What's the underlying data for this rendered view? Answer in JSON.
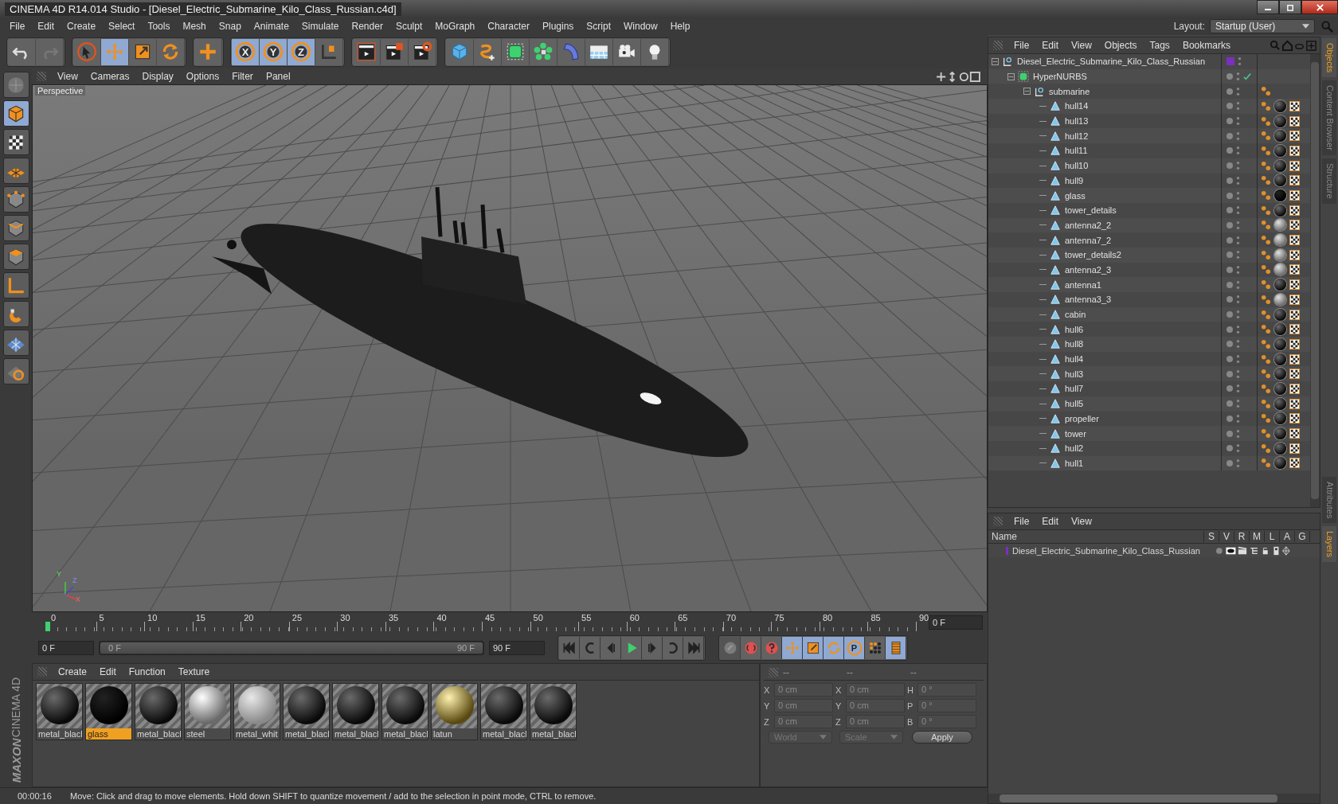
{
  "window": {
    "title": "CINEMA 4D R14.014 Studio - [Diesel_Electric_Submarine_Kilo_Class_Russian.c4d]"
  },
  "menu_bar": [
    "File",
    "Edit",
    "Create",
    "Select",
    "Tools",
    "Mesh",
    "Snap",
    "Animate",
    "Simulate",
    "Render",
    "Sculpt",
    "MoGraph",
    "Character",
    "Plugins",
    "Script",
    "Window",
    "Help"
  ],
  "layout": {
    "label": "Layout:",
    "value": "Startup (User)"
  },
  "toolbar": [
    [
      {
        "kind": "undo",
        "selected": false
      },
      {
        "kind": "redo",
        "selected": false
      }
    ],
    [
      {
        "kind": "select",
        "selected": false
      },
      {
        "kind": "move",
        "selected": true
      },
      {
        "kind": "scale",
        "selected": false
      },
      {
        "kind": "rotate",
        "selected": false
      }
    ],
    [
      {
        "kind": "add",
        "selected": false
      }
    ],
    [
      {
        "kind": "axis",
        "label": "X",
        "selected": true
      },
      {
        "kind": "axis",
        "label": "Y",
        "selected": true
      },
      {
        "kind": "axis",
        "label": "Z",
        "selected": true
      },
      {
        "kind": "coords",
        "selected": false
      }
    ],
    [
      {
        "kind": "render-view",
        "selected": false
      },
      {
        "kind": "render-picture",
        "selected": false
      },
      {
        "kind": "render-settings",
        "selected": false
      }
    ],
    [
      {
        "kind": "cube",
        "selected": false
      },
      {
        "kind": "spline",
        "selected": false
      },
      {
        "kind": "nurbs",
        "selected": false
      },
      {
        "kind": "array",
        "selected": false
      },
      {
        "kind": "deformer",
        "selected": false
      },
      {
        "kind": "floor",
        "selected": false
      },
      {
        "kind": "camera",
        "selected": false
      },
      {
        "kind": "light",
        "selected": false
      }
    ]
  ],
  "left_tools": [
    {
      "kind": "view",
      "selected": false
    },
    {
      "kind": "model",
      "selected": true
    },
    {
      "kind": "texture",
      "selected": false
    },
    {
      "kind": "workplane",
      "selected": false
    },
    {
      "kind": "points",
      "selected": false
    },
    {
      "kind": "edges",
      "selected": false
    },
    {
      "kind": "polygons",
      "selected": false
    },
    {
      "kind": "axis-mode",
      "selected": false
    },
    {
      "kind": "magnet",
      "selected": false
    },
    {
      "kind": "snap-grid",
      "selected": false
    },
    {
      "kind": "snap-lock",
      "selected": false
    }
  ],
  "viewport": {
    "menu": [
      "View",
      "Cameras",
      "Display",
      "Options",
      "Filter",
      "Panel"
    ],
    "label": "Perspective",
    "axes": [
      "Y",
      "Z",
      "X"
    ]
  },
  "objects": {
    "menu": [
      "File",
      "Edit",
      "View",
      "Objects",
      "Tags",
      "Bookmarks"
    ],
    "tree": [
      {
        "name": "Diesel_Electric_Submarine_Kilo_Class_Russian",
        "kind": "null",
        "expanded": true,
        "color": "#7b2fbe",
        "children": [
          {
            "name": "HyperNURBS",
            "kind": "hypernurbs",
            "expanded": true,
            "enabled": true,
            "children": [
              {
                "name": "submarine",
                "kind": "null",
                "expanded": true,
                "tags": [
                  {
                    "kind": "phong"
                  }
                ],
                "children": [
                  {
                    "name": "hull14",
                    "kind": "polygon",
                    "tags": [
                      {
                        "kind": "phong"
                      },
                      {
                        "kind": "material-dark"
                      },
                      {
                        "kind": "uvw"
                      }
                    ]
                  },
                  {
                    "name": "hull13",
                    "kind": "polygon",
                    "tags": [
                      {
                        "kind": "phong"
                      },
                      {
                        "kind": "material-dark"
                      },
                      {
                        "kind": "uvw"
                      }
                    ]
                  },
                  {
                    "name": "hull12",
                    "kind": "polygon",
                    "tags": [
                      {
                        "kind": "phong"
                      },
                      {
                        "kind": "material-dark"
                      },
                      {
                        "kind": "uvw"
                      }
                    ]
                  },
                  {
                    "name": "hull11",
                    "kind": "polygon",
                    "tags": [
                      {
                        "kind": "phong"
                      },
                      {
                        "kind": "material-dark"
                      },
                      {
                        "kind": "uvw"
                      }
                    ]
                  },
                  {
                    "name": "hull10",
                    "kind": "polygon",
                    "tags": [
                      {
                        "kind": "phong"
                      },
                      {
                        "kind": "material-dark"
                      },
                      {
                        "kind": "uvw"
                      }
                    ]
                  },
                  {
                    "name": "hull9",
                    "kind": "polygon",
                    "tags": [
                      {
                        "kind": "phong"
                      },
                      {
                        "kind": "material-dark"
                      },
                      {
                        "kind": "uvw"
                      }
                    ]
                  },
                  {
                    "name": "glass",
                    "kind": "polygon",
                    "tags": [
                      {
                        "kind": "phong"
                      },
                      {
                        "kind": "material-black"
                      },
                      {
                        "kind": "uvw"
                      }
                    ]
                  },
                  {
                    "name": "tower_details",
                    "kind": "polygon",
                    "tags": [
                      {
                        "kind": "phong"
                      },
                      {
                        "kind": "material-dark"
                      },
                      {
                        "kind": "uvw"
                      }
                    ]
                  },
                  {
                    "name": "antenna2_2",
                    "kind": "polygon",
                    "tags": [
                      {
                        "kind": "phong"
                      },
                      {
                        "kind": "material-grey"
                      },
                      {
                        "kind": "uvw"
                      }
                    ]
                  },
                  {
                    "name": "antenna7_2",
                    "kind": "polygon",
                    "tags": [
                      {
                        "kind": "phong"
                      },
                      {
                        "kind": "material-grey"
                      },
                      {
                        "kind": "uvw"
                      }
                    ]
                  },
                  {
                    "name": "tower_details2",
                    "kind": "polygon",
                    "tags": [
                      {
                        "kind": "phong"
                      },
                      {
                        "kind": "material-grey"
                      },
                      {
                        "kind": "uvw"
                      }
                    ]
                  },
                  {
                    "name": "antenna2_3",
                    "kind": "polygon",
                    "tags": [
                      {
                        "kind": "phong"
                      },
                      {
                        "kind": "material-grey"
                      },
                      {
                        "kind": "uvw"
                      }
                    ]
                  },
                  {
                    "name": "antenna1",
                    "kind": "polygon",
                    "tags": [
                      {
                        "kind": "phong"
                      },
                      {
                        "kind": "material-dark"
                      },
                      {
                        "kind": "uvw"
                      }
                    ]
                  },
                  {
                    "name": "antenna3_3",
                    "kind": "polygon",
                    "tags": [
                      {
                        "kind": "phong"
                      },
                      {
                        "kind": "material-grey"
                      },
                      {
                        "kind": "uvw"
                      }
                    ]
                  },
                  {
                    "name": "cabin",
                    "kind": "polygon",
                    "tags": [
                      {
                        "kind": "phong"
                      },
                      {
                        "kind": "material-dark"
                      },
                      {
                        "kind": "uvw"
                      }
                    ]
                  },
                  {
                    "name": "hull6",
                    "kind": "polygon",
                    "tags": [
                      {
                        "kind": "phong"
                      },
                      {
                        "kind": "material-dark"
                      },
                      {
                        "kind": "uvw"
                      }
                    ]
                  },
                  {
                    "name": "hull8",
                    "kind": "polygon",
                    "tags": [
                      {
                        "kind": "phong"
                      },
                      {
                        "kind": "material-dark"
                      },
                      {
                        "kind": "uvw"
                      }
                    ]
                  },
                  {
                    "name": "hull4",
                    "kind": "polygon",
                    "tags": [
                      {
                        "kind": "phong"
                      },
                      {
                        "kind": "material-dark"
                      },
                      {
                        "kind": "uvw"
                      }
                    ]
                  },
                  {
                    "name": "hull3",
                    "kind": "polygon",
                    "tags": [
                      {
                        "kind": "phong"
                      },
                      {
                        "kind": "material-dark"
                      },
                      {
                        "kind": "uvw"
                      }
                    ]
                  },
                  {
                    "name": "hull7",
                    "kind": "polygon",
                    "tags": [
                      {
                        "kind": "phong"
                      },
                      {
                        "kind": "material-dark"
                      },
                      {
                        "kind": "uvw"
                      }
                    ]
                  },
                  {
                    "name": "hull5",
                    "kind": "polygon",
                    "tags": [
                      {
                        "kind": "phong"
                      },
                      {
                        "kind": "material-dark"
                      },
                      {
                        "kind": "uvw"
                      }
                    ]
                  },
                  {
                    "name": "propeller",
                    "kind": "polygon",
                    "tags": [
                      {
                        "kind": "phong"
                      },
                      {
                        "kind": "material-dark"
                      },
                      {
                        "kind": "uvw"
                      }
                    ]
                  },
                  {
                    "name": "tower",
                    "kind": "polygon",
                    "tags": [
                      {
                        "kind": "phong"
                      },
                      {
                        "kind": "material-dark"
                      },
                      {
                        "kind": "uvw"
                      }
                    ]
                  },
                  {
                    "name": "hull2",
                    "kind": "polygon",
                    "tags": [
                      {
                        "kind": "phong"
                      },
                      {
                        "kind": "material-dark"
                      },
                      {
                        "kind": "uvw"
                      }
                    ]
                  },
                  {
                    "name": "hull1",
                    "kind": "polygon",
                    "tags": [
                      {
                        "kind": "phong"
                      },
                      {
                        "kind": "material-dark"
                      },
                      {
                        "kind": "uvw"
                      }
                    ]
                  }
                ]
              }
            ]
          }
        ]
      }
    ]
  },
  "side_tabs_top": [
    {
      "label": "Objects",
      "selected": true
    },
    {
      "label": "Content Browser",
      "selected": false
    },
    {
      "label": "Structure",
      "selected": false
    }
  ],
  "side_tabs_bottom": [
    {
      "label": "Attributes",
      "selected": false
    },
    {
      "label": "Layers",
      "selected": true
    }
  ],
  "layers": {
    "menu": [
      "File",
      "Edit",
      "View"
    ],
    "columns": [
      "Name",
      "S",
      "V",
      "R",
      "M",
      "L",
      "A",
      "G"
    ],
    "rows": [
      {
        "name": "Diesel_Electric_Submarine_Kilo_Class_Russian",
        "color": "#7b2fbe"
      }
    ]
  },
  "timeline": {
    "ticks": [
      "0",
      "5",
      "10",
      "15",
      "20",
      "25",
      "30",
      "35",
      "40",
      "45",
      "50",
      "55",
      "60",
      "65",
      "70",
      "75",
      "80",
      "85",
      "90"
    ],
    "current_frame": "0 F",
    "start": "0 F",
    "range": {
      "start": "0 F",
      "end": "90 F",
      "level": 1
    },
    "end": "90 F",
    "playback": [
      {
        "kind": "go-start"
      },
      {
        "kind": "loop-back"
      },
      {
        "kind": "step-back"
      },
      {
        "kind": "play"
      },
      {
        "kind": "step-forward"
      },
      {
        "kind": "loop"
      },
      {
        "kind": "go-end"
      }
    ],
    "keys": [
      {
        "kind": "record",
        "disabled": true
      },
      {
        "kind": "autokey",
        "disabled": false
      },
      {
        "kind": "help",
        "disabled": false
      },
      {
        "kind": "key-move",
        "selected": true
      },
      {
        "kind": "key-scale",
        "selected": true
      },
      {
        "kind": "key-rotate",
        "selected": true
      },
      {
        "kind": "key-param",
        "label": "P",
        "selected": true
      },
      {
        "kind": "key-points",
        "selected": false
      },
      {
        "kind": "film",
        "selected": true
      }
    ]
  },
  "materials": {
    "menu": [
      "Create",
      "Edit",
      "Function",
      "Texture"
    ],
    "items": [
      {
        "name": "metal_blacl",
        "kind": "dark",
        "selected": false
      },
      {
        "name": "glass",
        "kind": "black",
        "selected": true
      },
      {
        "name": "metal_blacl",
        "kind": "dark",
        "selected": false
      },
      {
        "name": "steel",
        "kind": "light",
        "selected": false
      },
      {
        "name": "metal_whit",
        "kind": "white",
        "selected": false
      },
      {
        "name": "metal_blacl",
        "kind": "dark",
        "selected": false
      },
      {
        "name": "metal_blacl",
        "kind": "dark",
        "selected": false
      },
      {
        "name": "metal_blacl",
        "kind": "dark",
        "selected": false
      },
      {
        "name": "latun",
        "kind": "gold",
        "selected": false
      },
      {
        "name": "metal_blacl",
        "kind": "dark",
        "selected": false
      },
      {
        "name": "metal_blacl",
        "kind": "dark",
        "selected": false
      }
    ]
  },
  "coordinates": {
    "headers": [
      "--",
      "--",
      "--"
    ],
    "rows": [
      [
        {
          "axis": "X",
          "value": "0 cm"
        },
        {
          "axis": "X",
          "value": "0 cm"
        },
        {
          "axis": "H",
          "value": "0 °"
        }
      ],
      [
        {
          "axis": "Y",
          "value": "0 cm"
        },
        {
          "axis": "Y",
          "value": "0 cm"
        },
        {
          "axis": "P",
          "value": "0 °"
        }
      ],
      [
        {
          "axis": "Z",
          "value": "0 cm"
        },
        {
          "axis": "Z",
          "value": "0 cm"
        },
        {
          "axis": "B",
          "value": "0 °"
        }
      ]
    ],
    "space": "World",
    "mode": "Scale",
    "apply": "Apply",
    "disabled": true
  },
  "logo": {
    "brand": "MAXON",
    "product": "CINEMA 4D"
  },
  "status_bar": {
    "time": "00:00:16",
    "message": "Move: Click and drag to move elements. Hold down SHIFT to quantize movement / add to the selection in point mode, CTRL to remove."
  }
}
